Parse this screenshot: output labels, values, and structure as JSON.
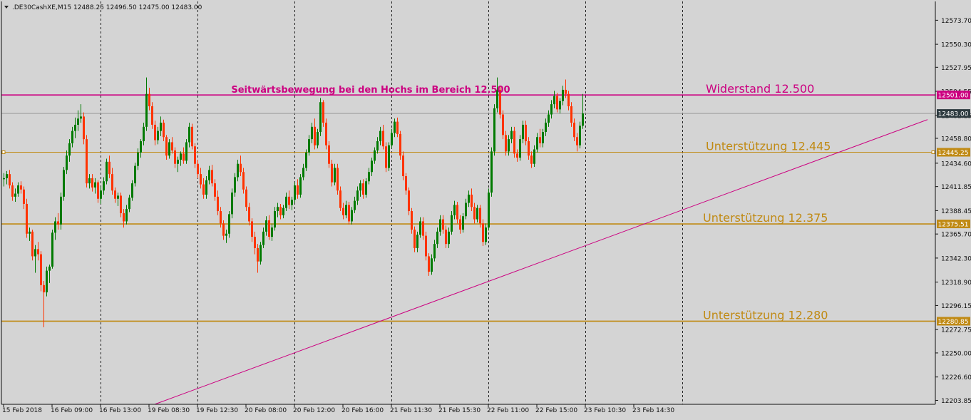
{
  "header": {
    "symbol_timeframe": ".DE30CashXE,M15",
    "ohlc": "12488.25 12496.50 12475.00 12483.00",
    "menu_icon": "triangle-down-icon"
  },
  "colors": {
    "background": "#d4d4d4",
    "bull": "#007a00",
    "bear": "#ff3300",
    "resistance": "#cc0080",
    "support": "#c08a14",
    "trendline": "#cc0080",
    "current_price_box": "#2d3a3f"
  },
  "chart_data": {
    "type": "candlestick",
    "title": "Seitwärtsbewegung bei den Hochs im Bereich 12.500",
    "ylim": [
      12200,
      12592
    ],
    "y_ticks": [
      "12573.70",
      "12550.30",
      "12527.95",
      "12504.55",
      "12481.15",
      "12458.80",
      "12434.60",
      "12411.85",
      "12388.45",
      "12365.70",
      "12342.30",
      "12318.90",
      "12296.15",
      "12272.75",
      "12250.00",
      "12226.60",
      "12203.85"
    ],
    "x_labels": [
      "15 Feb 2018",
      "16 Feb 09:00",
      "16 Feb 13:00",
      "19 Feb 08:30",
      "19 Feb 12:30",
      "20 Feb 08:00",
      "20 Feb 12:00",
      "20 Feb 16:00",
      "21 Feb 11:30",
      "21 Feb 15:30",
      "22 Feb 11:00",
      "22 Feb 15:00",
      "23 Feb 10:30",
      "23 Feb 14:30"
    ],
    "grid": "vertical-dashed",
    "levels": [
      {
        "name": "Widerstand 12.500",
        "price": 12501.0,
        "price_label": "12501.00",
        "kind": "resistance"
      },
      {
        "name": "Unterstützung 12.445",
        "price": 12445.25,
        "price_label": "12445.25",
        "kind": "support"
      },
      {
        "name": "Unterstützung 12.375",
        "price": 12375.51,
        "price_label": "12375.51",
        "kind": "support"
      },
      {
        "name": "Unterstützung 12.280",
        "price": 12280.85,
        "price_label": "12280.85",
        "kind": "support"
      }
    ],
    "current_price": {
      "price": 12483.0,
      "label": "12483.00"
    },
    "trendline": {
      "start": {
        "bar": 53,
        "price": 12200
      },
      "end": {
        "bar": 324,
        "price": 12477
      }
    },
    "bars_per_period": 34,
    "candles": [
      [
        12419,
        12425,
        12412,
        12420
      ],
      [
        12420,
        12427,
        12414,
        12424
      ],
      [
        12424,
        12428,
        12410,
        12413
      ],
      [
        12413,
        12416,
        12398,
        12402
      ],
      [
        12402,
        12410,
        12397,
        12405
      ],
      [
        12405,
        12416,
        12402,
        12413
      ],
      [
        12413,
        12417,
        12405,
        12409
      ],
      [
        12409,
        12412,
        12390,
        12395
      ],
      [
        12395,
        12400,
        12362,
        12366
      ],
      [
        12366,
        12372,
        12359,
        12368
      ],
      [
        12368,
        12370,
        12340,
        12344
      ],
      [
        12344,
        12355,
        12328,
        12351
      ],
      [
        12351,
        12358,
        12340,
        12346
      ],
      [
        12346,
        12349,
        12310,
        12316
      ],
      [
        12316,
        12320,
        12275,
        12309
      ],
      [
        12309,
        12334,
        12305,
        12330
      ],
      [
        12330,
        12336,
        12318,
        12334
      ],
      [
        12334,
        12370,
        12332,
        12367
      ],
      [
        12367,
        12382,
        12360,
        12378
      ],
      [
        12378,
        12386,
        12370,
        12375
      ],
      [
        12375,
        12406,
        12370,
        12402
      ],
      [
        12402,
        12431,
        12398,
        12428
      ],
      [
        12428,
        12447,
        12424,
        12442
      ],
      [
        12442,
        12458,
        12436,
        12454
      ],
      [
        12454,
        12470,
        12450,
        12466
      ],
      [
        12466,
        12479,
        12459,
        12472
      ],
      [
        12472,
        12486,
        12466,
        12478
      ],
      [
        12478,
        12492,
        12474,
        12480
      ],
      [
        12480,
        12484,
        12453,
        12458
      ],
      [
        12458,
        12462,
        12411,
        12415
      ],
      [
        12415,
        12424,
        12410,
        12420
      ],
      [
        12420,
        12424,
        12407,
        12411
      ],
      [
        12411,
        12420,
        12405,
        12416
      ],
      [
        12416,
        12418,
        12396,
        12400
      ],
      [
        12400,
        12412,
        12395,
        12408
      ],
      [
        12408,
        12421,
        12404,
        12417
      ],
      [
        12417,
        12439,
        12414,
        12436
      ],
      [
        12436,
        12442,
        12420,
        12424
      ],
      [
        12424,
        12430,
        12404,
        12408
      ],
      [
        12408,
        12411,
        12396,
        12400
      ],
      [
        12400,
        12406,
        12393,
        12403
      ],
      [
        12403,
        12406,
        12382,
        12386
      ],
      [
        12386,
        12390,
        12372,
        12378
      ],
      [
        12378,
        12394,
        12375,
        12390
      ],
      [
        12390,
        12404,
        12387,
        12401
      ],
      [
        12401,
        12418,
        12398,
        12415
      ],
      [
        12415,
        12435,
        12412,
        12432
      ],
      [
        12432,
        12449,
        12428,
        12445
      ],
      [
        12445,
        12458,
        12440,
        12456
      ],
      [
        12456,
        12474,
        12452,
        12470
      ],
      [
        12470,
        12518,
        12466,
        12502
      ],
      [
        12502,
        12508,
        12486,
        12490
      ],
      [
        12490,
        12494,
        12468,
        12472
      ],
      [
        12472,
        12476,
        12452,
        12457
      ],
      [
        12457,
        12470,
        12453,
        12466
      ],
      [
        12466,
        12480,
        12461,
        12474
      ],
      [
        12474,
        12477,
        12456,
        12460
      ],
      [
        12460,
        12462,
        12438,
        12442
      ],
      [
        12442,
        12458,
        12439,
        12455
      ],
      [
        12455,
        12460,
        12444,
        12447
      ],
      [
        12447,
        12450,
        12430,
        12434
      ],
      [
        12434,
        12441,
        12426,
        12438
      ],
      [
        12438,
        12446,
        12432,
        12444
      ],
      [
        12444,
        12450,
        12434,
        12437
      ],
      [
        12437,
        12458,
        12434,
        12455
      ],
      [
        12455,
        12474,
        12450,
        12470
      ],
      [
        12470,
        12473,
        12448,
        12451
      ],
      [
        12451,
        12454,
        12430,
        12434
      ],
      [
        12434,
        12438,
        12420,
        12424
      ],
      [
        12424,
        12430,
        12410,
        12414
      ],
      [
        12414,
        12420,
        12400,
        12404
      ],
      [
        12404,
        12422,
        12400,
        12418
      ],
      [
        12418,
        12432,
        12414,
        12428
      ],
      [
        12428,
        12433,
        12412,
        12415
      ],
      [
        12415,
        12419,
        12398,
        12402
      ],
      [
        12402,
        12408,
        12384,
        12388
      ],
      [
        12388,
        12392,
        12372,
        12376
      ],
      [
        12376,
        12379,
        12360,
        12364
      ],
      [
        12364,
        12370,
        12357,
        12366
      ],
      [
        12366,
        12388,
        12362,
        12385
      ],
      [
        12385,
        12410,
        12381,
        12406
      ],
      [
        12406,
        12425,
        12402,
        12421
      ],
      [
        12421,
        12438,
        12417,
        12434
      ],
      [
        12434,
        12442,
        12422,
        12426
      ],
      [
        12426,
        12430,
        12405,
        12409
      ],
      [
        12409,
        12412,
        12388,
        12392
      ],
      [
        12392,
        12396,
        12374,
        12378
      ],
      [
        12378,
        12381,
        12358,
        12363
      ],
      [
        12363,
        12368,
        12346,
        12352
      ],
      [
        12352,
        12356,
        12328,
        12339
      ],
      [
        12339,
        12358,
        12336,
        12355
      ],
      [
        12355,
        12372,
        12352,
        12368
      ],
      [
        12368,
        12383,
        12364,
        12379
      ],
      [
        12379,
        12384,
        12360,
        12363
      ],
      [
        12363,
        12376,
        12359,
        12372
      ],
      [
        12372,
        12392,
        12369,
        12388
      ],
      [
        12388,
        12396,
        12382,
        12392
      ],
      [
        12392,
        12395,
        12380,
        12384
      ],
      [
        12384,
        12394,
        12381,
        12391
      ],
      [
        12391,
        12406,
        12388,
        12402
      ],
      [
        12402,
        12408,
        12390,
        12394
      ],
      [
        12394,
        12402,
        12389,
        12399
      ],
      [
        12399,
        12416,
        12396,
        12413
      ],
      [
        12413,
        12419,
        12400,
        12404
      ],
      [
        12404,
        12424,
        12401,
        12421
      ],
      [
        12421,
        12434,
        12418,
        12430
      ],
      [
        12430,
        12448,
        12427,
        12445
      ],
      [
        12445,
        12462,
        12442,
        12458
      ],
      [
        12458,
        12474,
        12454,
        12470
      ],
      [
        12470,
        12478,
        12448,
        12452
      ],
      [
        12452,
        12468,
        12449,
        12465
      ],
      [
        12465,
        12498,
        12461,
        12494
      ],
      [
        12494,
        12496,
        12470,
        12474
      ],
      [
        12474,
        12478,
        12448,
        12452
      ],
      [
        12452,
        12456,
        12430,
        12434
      ],
      [
        12434,
        12438,
        12412,
        12416
      ],
      [
        12416,
        12434,
        12413,
        12430
      ],
      [
        12430,
        12434,
        12404,
        12408
      ],
      [
        12408,
        12412,
        12388,
        12391
      ],
      [
        12391,
        12396,
        12380,
        12384
      ],
      [
        12384,
        12398,
        12381,
        12394
      ],
      [
        12394,
        12397,
        12375,
        12378
      ],
      [
        12378,
        12392,
        12375,
        12389
      ],
      [
        12389,
        12402,
        12386,
        12398
      ],
      [
        12398,
        12412,
        12394,
        12408
      ],
      [
        12408,
        12418,
        12402,
        12415
      ],
      [
        12415,
        12419,
        12400,
        12404
      ],
      [
        12404,
        12420,
        12401,
        12417
      ],
      [
        12417,
        12430,
        12414,
        12426
      ],
      [
        12426,
        12440,
        12422,
        12437
      ],
      [
        12437,
        12450,
        12434,
        12447
      ],
      [
        12447,
        12460,
        12444,
        12456
      ],
      [
        12456,
        12470,
        12452,
        12466
      ],
      [
        12466,
        12472,
        12448,
        12451
      ],
      [
        12451,
        12455,
        12426,
        12430
      ],
      [
        12430,
        12455,
        12427,
        12452
      ],
      [
        12452,
        12468,
        12449,
        12464
      ],
      [
        12464,
        12478,
        12460,
        12475
      ],
      [
        12475,
        12479,
        12460,
        12463
      ],
      [
        12463,
        12466,
        12438,
        12442
      ],
      [
        12442,
        12446,
        12418,
        12422
      ],
      [
        12422,
        12425,
        12404,
        12408
      ],
      [
        12408,
        12411,
        12384,
        12388
      ],
      [
        12388,
        12391,
        12366,
        12370
      ],
      [
        12370,
        12373,
        12348,
        12352
      ],
      [
        12352,
        12368,
        12348,
        12365
      ],
      [
        12365,
        12382,
        12362,
        12378
      ],
      [
        12378,
        12382,
        12360,
        12364
      ],
      [
        12364,
        12368,
        12340,
        12344
      ],
      [
        12344,
        12347,
        12325,
        12329
      ],
      [
        12329,
        12346,
        12326,
        12342
      ],
      [
        12342,
        12360,
        12339,
        12356
      ],
      [
        12356,
        12372,
        12352,
        12368
      ],
      [
        12368,
        12384,
        12364,
        12380
      ],
      [
        12380,
        12384,
        12366,
        12370
      ],
      [
        12370,
        12374,
        12352,
        12356
      ],
      [
        12356,
        12372,
        12352,
        12368
      ],
      [
        12368,
        12388,
        12365,
        12384
      ],
      [
        12384,
        12398,
        12380,
        12394
      ],
      [
        12394,
        12397,
        12376,
        12380
      ],
      [
        12380,
        12384,
        12366,
        12370
      ],
      [
        12370,
        12386,
        12367,
        12383
      ],
      [
        12383,
        12400,
        12380,
        12396
      ],
      [
        12396,
        12408,
        12392,
        12404
      ],
      [
        12404,
        12410,
        12388,
        12392
      ],
      [
        12392,
        12396,
        12376,
        12380
      ],
      [
        12380,
        12394,
        12377,
        12391
      ],
      [
        12391,
        12394,
        12372,
        12376
      ],
      [
        12376,
        12380,
        12354,
        12358
      ],
      [
        12358,
        12376,
        12355,
        12372
      ],
      [
        12372,
        12410,
        12369,
        12406
      ],
      [
        12406,
        12450,
        12402,
        12446
      ],
      [
        12446,
        12492,
        12442,
        12488
      ],
      [
        12488,
        12518,
        12484,
        12506
      ],
      [
        12506,
        12510,
        12478,
        12482
      ],
      [
        12482,
        12486,
        12458,
        12462
      ],
      [
        12462,
        12466,
        12442,
        12446
      ],
      [
        12446,
        12462,
        12442,
        12458
      ],
      [
        12458,
        12470,
        12454,
        12466
      ],
      [
        12466,
        12470,
        12440,
        12444
      ],
      [
        12444,
        12448,
        12436,
        12440
      ],
      [
        12440,
        12462,
        12437,
        12458
      ],
      [
        12458,
        12476,
        12454,
        12472
      ],
      [
        12472,
        12476,
        12452,
        12456
      ],
      [
        12456,
        12460,
        12438,
        12442
      ],
      [
        12442,
        12446,
        12430,
        12434
      ],
      [
        12434,
        12452,
        12431,
        12448
      ],
      [
        12448,
        12464,
        12445,
        12460
      ],
      [
        12460,
        12468,
        12450,
        12454
      ],
      [
        12454,
        12468,
        12450,
        12465
      ],
      [
        12465,
        12478,
        12461,
        12474
      ],
      [
        12474,
        12486,
        12470,
        12482
      ],
      [
        12482,
        12496,
        12478,
        12492
      ],
      [
        12492,
        12505,
        12488,
        12500
      ],
      [
        12500,
        12503,
        12484,
        12487
      ],
      [
        12487,
        12498,
        12483,
        12495
      ],
      [
        12495,
        12510,
        12491,
        12506
      ],
      [
        12506,
        12516,
        12498,
        12502
      ],
      [
        12502,
        12505,
        12486,
        12490
      ],
      [
        12490,
        12494,
        12470,
        12474
      ],
      [
        12474,
        12478,
        12456,
        12460
      ],
      [
        12460,
        12464,
        12446,
        12452
      ],
      [
        12452,
        12475,
        12449,
        12471
      ],
      [
        12471,
        12502,
        12468,
        12483
      ]
    ]
  }
}
